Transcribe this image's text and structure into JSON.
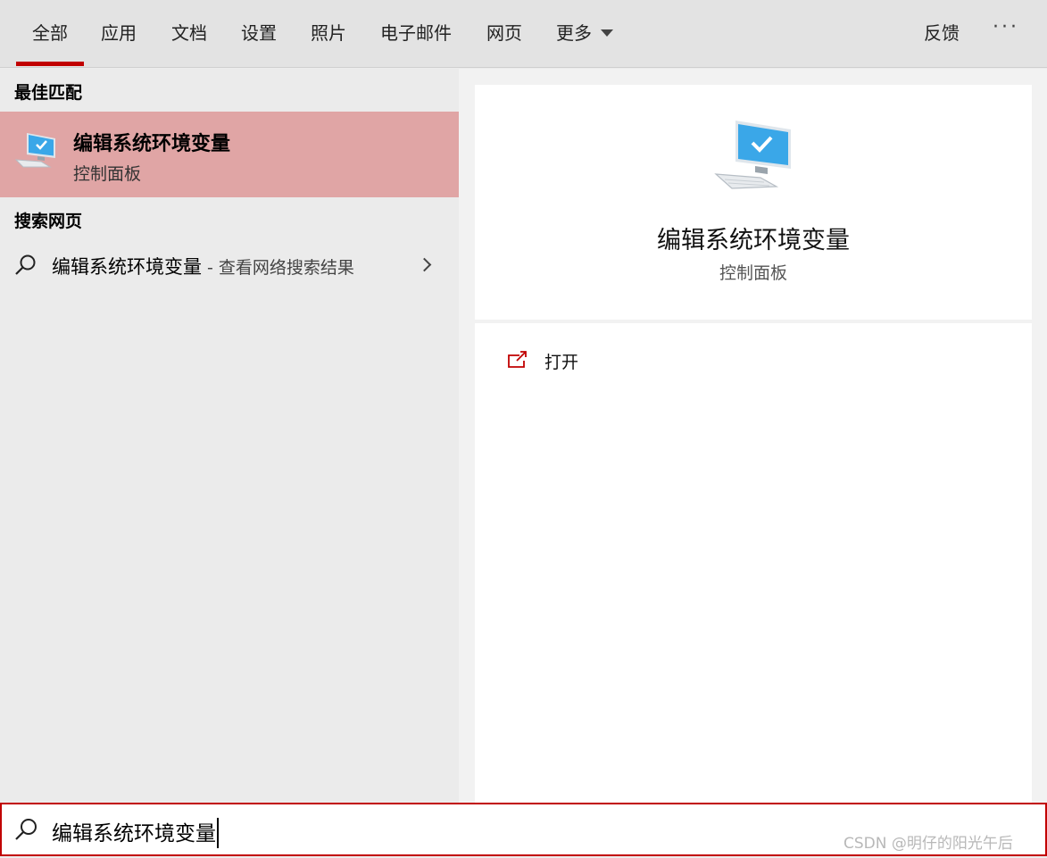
{
  "tabs": [
    {
      "label": "全部",
      "active": true
    },
    {
      "label": "应用"
    },
    {
      "label": "文档"
    },
    {
      "label": "设置"
    },
    {
      "label": "照片"
    },
    {
      "label": "电子邮件"
    },
    {
      "label": "网页"
    },
    {
      "label": "更多"
    }
  ],
  "toolbar": {
    "feedback_label": "反馈",
    "more_options": "···"
  },
  "best_match": {
    "header": "最佳匹配",
    "title": "编辑系统环境变量",
    "subtitle": "控制面板",
    "icon": "control-panel-monitor-icon"
  },
  "web_search": {
    "header": "搜索网页",
    "query": "编辑系统环境变量",
    "suffix": " - 查看网络搜索结果"
  },
  "detail": {
    "title": "编辑系统环境变量",
    "subtitle": "控制面板",
    "actions": [
      {
        "label": "打开",
        "icon": "open-external-icon"
      }
    ]
  },
  "search": {
    "value": "编辑系统环境变量"
  },
  "watermark": "CSDN @明仔的阳光午后",
  "colors": {
    "accent": "#c10000",
    "selection": "#e0a5a5"
  }
}
